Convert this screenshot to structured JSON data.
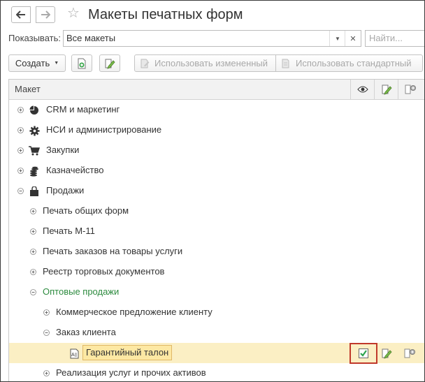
{
  "window": {
    "title": "Макеты печатных форм"
  },
  "filter": {
    "label": "Показывать:",
    "value": "Все макеты",
    "search_placeholder": "Найти..."
  },
  "toolbar": {
    "create_label": "Создать",
    "use_changed_label": "Использовать измененный",
    "use_standard_label": "Использовать стандартный"
  },
  "table": {
    "column_header": "Макет",
    "rows": [
      {
        "label": "CRM и маркетинг",
        "icon": "pie-chart-icon",
        "level": 0,
        "state": "collapsed"
      },
      {
        "label": "НСИ и администрирование",
        "icon": "gear-icon",
        "level": 0,
        "state": "collapsed"
      },
      {
        "label": "Закупки",
        "icon": "cart-icon",
        "level": 0,
        "state": "collapsed"
      },
      {
        "label": "Казначейство",
        "icon": "coins-icon",
        "level": 0,
        "state": "collapsed"
      },
      {
        "label": "Продажи",
        "icon": "bag-icon",
        "level": 0,
        "state": "expanded"
      },
      {
        "label": "Печать общих форм",
        "level": 1,
        "state": "collapsed"
      },
      {
        "label": "Печать М-11",
        "level": 1,
        "state": "collapsed"
      },
      {
        "label": "Печать заказов на товары услуги",
        "level": 1,
        "state": "collapsed"
      },
      {
        "label": "Реестр торговых документов",
        "level": 1,
        "state": "collapsed"
      },
      {
        "label": "Оптовые продажи",
        "level": 1,
        "state": "expanded"
      },
      {
        "label": "Коммерческое предложение клиенту",
        "level": 2,
        "state": "collapsed"
      },
      {
        "label": "Заказ клиента",
        "level": 2,
        "state": "expanded"
      },
      {
        "label": "Гарантийный талон",
        "level": 3,
        "state": "leaf",
        "icon": "document-template-icon",
        "selected": true,
        "used": true
      },
      {
        "label": "Реализация услуг и прочих активов",
        "level": 2,
        "state": "collapsed"
      }
    ]
  },
  "colors": {
    "accent_green": "#2d8b3f",
    "selection": "#fbefc4",
    "highlight_border": "#c0392b"
  }
}
